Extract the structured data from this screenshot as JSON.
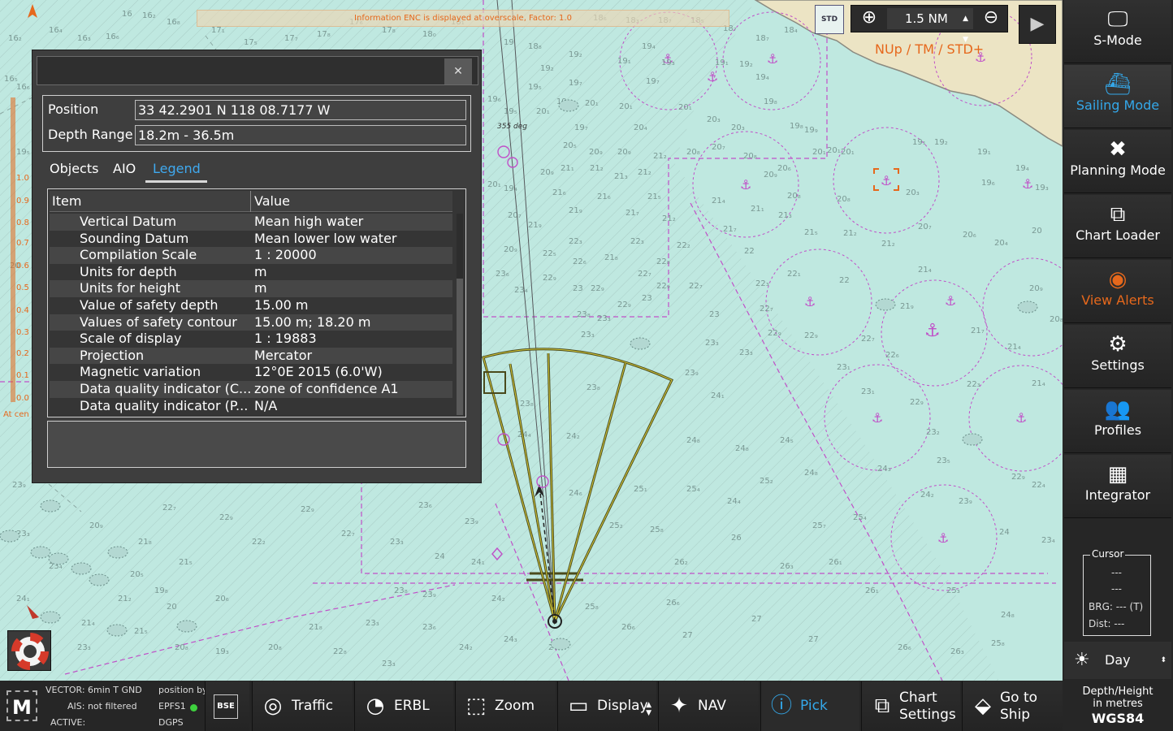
{
  "banner": {
    "text": "Information ENC is displayed at overscale, Factor: 1.0"
  },
  "zoom": {
    "value": "1.5 NM"
  },
  "std_label": "STD",
  "orientation": "NUp / TM / STD+",
  "chart_notes": {
    "heading": "355 deg",
    "at_centre": "At cen"
  },
  "panel": {
    "position_label": "Position",
    "position_value": "33 42.2901 N  118 08.7177 W",
    "depth_label": "Depth Range",
    "depth_value": "18.2m - 36.5m",
    "tabs": [
      "Objects",
      "AIO",
      "Legend"
    ],
    "table": {
      "headers": [
        "Item",
        "Value"
      ],
      "rows": [
        {
          "item": "Vertical Datum",
          "value": "Mean high water"
        },
        {
          "item": "Sounding Datum",
          "value": "Mean lower low water"
        },
        {
          "item": "Compilation Scale",
          "value": "1 : 20000"
        },
        {
          "item": "Units for depth",
          "value": "m"
        },
        {
          "item": "Units for height",
          "value": "m"
        },
        {
          "item": "Value of safety depth",
          "value": "15.00 m"
        },
        {
          "item": "Values of safety contour",
          "value": "15.00 m; 18.20 m"
        },
        {
          "item": "Scale of display",
          "value": "1 : 19883"
        },
        {
          "item": "Projection",
          "value": "Mercator"
        },
        {
          "item": "Magnetic variation",
          "value": "12°0E 2015 (6.0'W)"
        },
        {
          "item": "Data quality indicator (C...",
          "value": "zone of confidence A1"
        },
        {
          "item": "Data quality indicator (P...",
          "value": "N/A"
        }
      ]
    }
  },
  "sidebar": {
    "items": [
      {
        "label": "S-Mode",
        "icon": "monitor-icon"
      },
      {
        "label": "Sailing Mode",
        "icon": "ship-icon"
      },
      {
        "label": "Planning Mode",
        "icon": "tools-icon"
      },
      {
        "label": "Chart Loader",
        "icon": "chart-loader-icon"
      },
      {
        "label": "View Alerts",
        "icon": "alert-icon"
      },
      {
        "label": "Settings",
        "icon": "gear-icon"
      },
      {
        "label": "Profiles",
        "icon": "users-icon"
      },
      {
        "label": "Integrator",
        "icon": "integrator-icon"
      }
    ],
    "cursor": {
      "title": "Cursor",
      "line1": "---",
      "line2": "---",
      "brg": "BRG: --- (T)",
      "dist": "Dist: ---"
    },
    "day": "Day",
    "depth_height": "Depth/Height",
    "in_metres": "in metres",
    "datum": "WGS84"
  },
  "status": {
    "vector": "VECTOR: 6min T GND",
    "ais": "AIS: not filtered",
    "active": "ACTIVE:",
    "position_by": "position by",
    "sensor": "EPFS1",
    "fix": "DGPS"
  },
  "bottom_bar": {
    "bse": "BSE",
    "traffic": "Traffic",
    "erbl": "ERBL",
    "zoom": "Zoom",
    "display": "Display",
    "nav": "NAV",
    "pick": "Pick",
    "chart_settings_1": "Chart",
    "chart_settings_2": "Settings",
    "goto_1": "Go to",
    "goto_2": "Ship"
  },
  "colors": {
    "sea": "#bfe8e0",
    "land": "#ece4c4",
    "magenta": "#c050c8",
    "accent_blue": "#34a8ea",
    "orange": "#e6681c",
    "ownship_sector": "#4a4a1c"
  }
}
